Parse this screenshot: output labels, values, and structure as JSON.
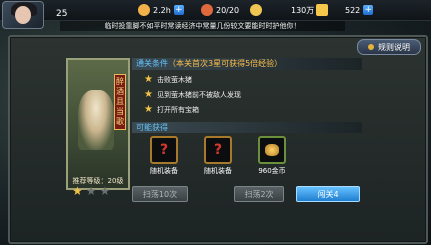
{
  "player": {
    "level": "25"
  },
  "top_resources": [
    {
      "name": "stamina",
      "value": "2.2h",
      "icon": "stamina-icon",
      "color": "#f2b24a"
    },
    {
      "name": "energy",
      "value": "20/20",
      "icon": "fist-icon",
      "color": "#e0683d"
    },
    {
      "name": "coins",
      "value": "130万",
      "icon": "coin-icon",
      "color": "#f0c653"
    },
    {
      "name": "diamonds",
      "value": "522",
      "icon": "crown-gem-icon",
      "color": "#f6c74b"
    }
  ],
  "notice": "临时投靠脚不如平时常读经济中常量几份较文要能时时护他你！",
  "help_button": "规则说明",
  "stage_card": {
    "vertical_title": "醉酒且当歌",
    "recommend": "推荐等级：20级",
    "stars_filled": 1,
    "stars_total": 3
  },
  "conditions": {
    "header_label": "通关条件",
    "header_bonus": "（本关首次3星可获得5倍经验）",
    "items": [
      "击败萤木猪",
      "见到萤木猪前不被敌人发现",
      "打开所有宝箱"
    ]
  },
  "rewards": {
    "header": "可能获得",
    "items": [
      {
        "label": "随机装备",
        "icon": "mystery-equipment-icon"
      },
      {
        "label": "随机装备",
        "icon": "mystery-equipment-icon"
      },
      {
        "label": "960金币",
        "icon": "gold-pile-icon"
      }
    ]
  },
  "buttons": {
    "sweep10": "扫荡10次",
    "sweep2": "扫荡2次",
    "challenge": "闯关4"
  }
}
